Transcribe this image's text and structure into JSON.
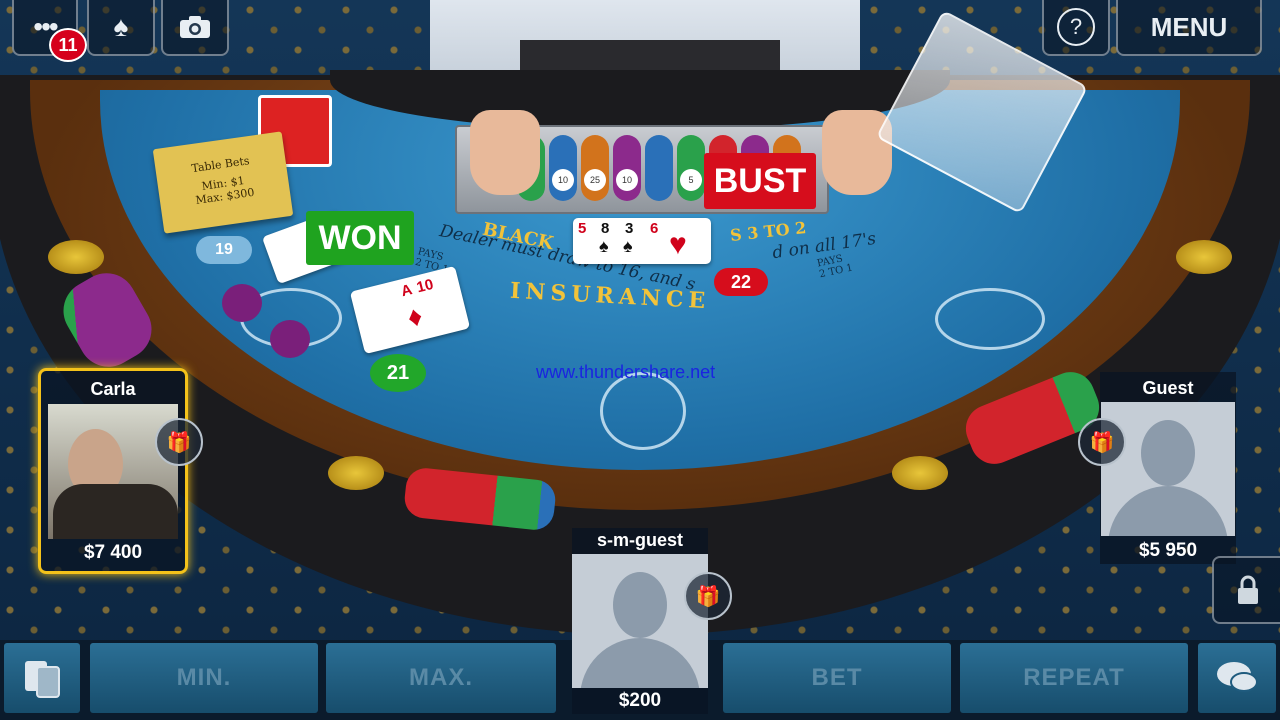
{
  "top_bar": {
    "notification_count": "11",
    "help_label": "?",
    "menu_label": "MENU"
  },
  "table_sign": {
    "title": "Table Bets",
    "min": "Min: $1",
    "max": "Max: $300"
  },
  "felt": {
    "blackjack_text": "BLACK",
    "pays_text": "S 3 TO 2",
    "dealer_rule": "Dealer must draw to 16, and s",
    "dealer_rule_end": "d on all 17's",
    "insurance": "INSURANCE",
    "pays_left": "PAYS\n2 TO 1",
    "pays_right": "PAYS\n2 TO 1"
  },
  "dealer": {
    "result": "BUST",
    "score": "22",
    "cards": [
      {
        "rank": "5",
        "suit": "♥",
        "color": "red"
      },
      {
        "rank": "8",
        "suit": "♠",
        "color": "black"
      },
      {
        "rank": "3",
        "suit": "♠",
        "color": "black"
      },
      {
        "rank": "6",
        "suit": "♥",
        "color": "red"
      }
    ]
  },
  "hands": [
    {
      "score": "19",
      "cards": [
        {
          "rank": "",
          "suit": "♣",
          "color": "black"
        }
      ]
    },
    {
      "score": "21",
      "result": "WON",
      "cards": [
        {
          "rank": "A",
          "suit": "♦",
          "color": "red"
        },
        {
          "rank": "10",
          "suit": "♦",
          "color": "red"
        }
      ]
    }
  ],
  "watermark": "www.thundershare.net",
  "players": [
    {
      "name": "Carla",
      "money": "$7 400"
    },
    {
      "name": "Guest",
      "money": "$5 950"
    },
    {
      "name": "s-m-guest",
      "money": "$200"
    }
  ],
  "bottom_bar": {
    "min_label": "MIN.",
    "max_label": "MAX.",
    "bet_label": "BET",
    "repeat_label": "REPEAT"
  },
  "chip_labels": [
    "10",
    "25",
    "10",
    "5"
  ],
  "colors": {
    "felt": "#2a86c2",
    "bust_red": "#d60d1c",
    "won_green": "#1fa31f",
    "highlight_gold": "#f4c21a"
  }
}
